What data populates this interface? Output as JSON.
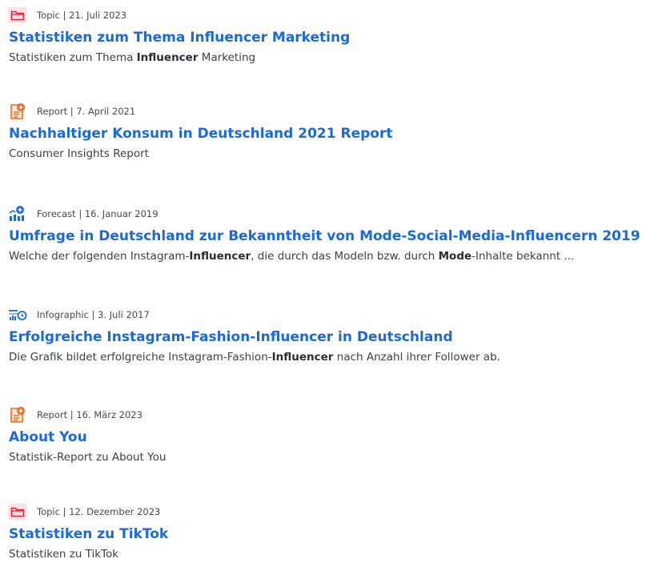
{
  "results": [
    {
      "type": "Topic",
      "date": "21. Juli 2023",
      "icon": "folder-icon",
      "title": "Statistiken zum Thema Influencer Marketing",
      "desc_parts": [
        "Statistiken zum Thema ",
        "Influencer",
        " Marketing"
      ]
    },
    {
      "type": "Report",
      "date": "7. April 2021",
      "icon": "report-icon",
      "title": "Nachhaltiger Konsum in Deutschland 2021 Report",
      "desc_parts": [
        "Consumer Insights Report"
      ]
    },
    {
      "type": "Forecast",
      "date": "16. Januar 2019",
      "icon": "forecast-icon",
      "title": "Umfrage in Deutschland zur Bekanntheit von Mode-Social-Media-Influencern 2019",
      "desc_parts": [
        "Welche der folgenden Instagram-",
        "Influencer",
        ", die durch das Modeln bzw. durch ",
        "Mode",
        "-Inhalte bekannt ..."
      ]
    },
    {
      "type": "Infographic",
      "date": "3. Juli 2017",
      "icon": "infographic-icon",
      "title": "Erfolgreiche Instagram-Fashion-Influencer in Deutschland",
      "desc_parts": [
        "Die Grafik bildet erfolgreiche Instagram-Fashion-",
        "Influencer",
        " nach Anzahl ihrer Follower ab."
      ]
    },
    {
      "type": "Report",
      "date": "16. März 2023",
      "icon": "report-icon",
      "title": "About You",
      "desc_parts": [
        "Statistik-Report zu About You"
      ]
    },
    {
      "type": "Topic",
      "date": "12. Dezember 2023",
      "icon": "folder-icon",
      "title": "Statistiken zu TikTok",
      "desc_parts": [
        "Statistiken zu TikTok"
      ]
    }
  ],
  "separator": " | ",
  "colors": {
    "link": "#1a6ad8",
    "topic_icon": "#e0243a",
    "topic_icon_bg": "#fde3e6",
    "report_icon": "#f26b1d",
    "forecast_icon": "#1a6ad8",
    "infographic_icon": "#1a6ad8"
  }
}
